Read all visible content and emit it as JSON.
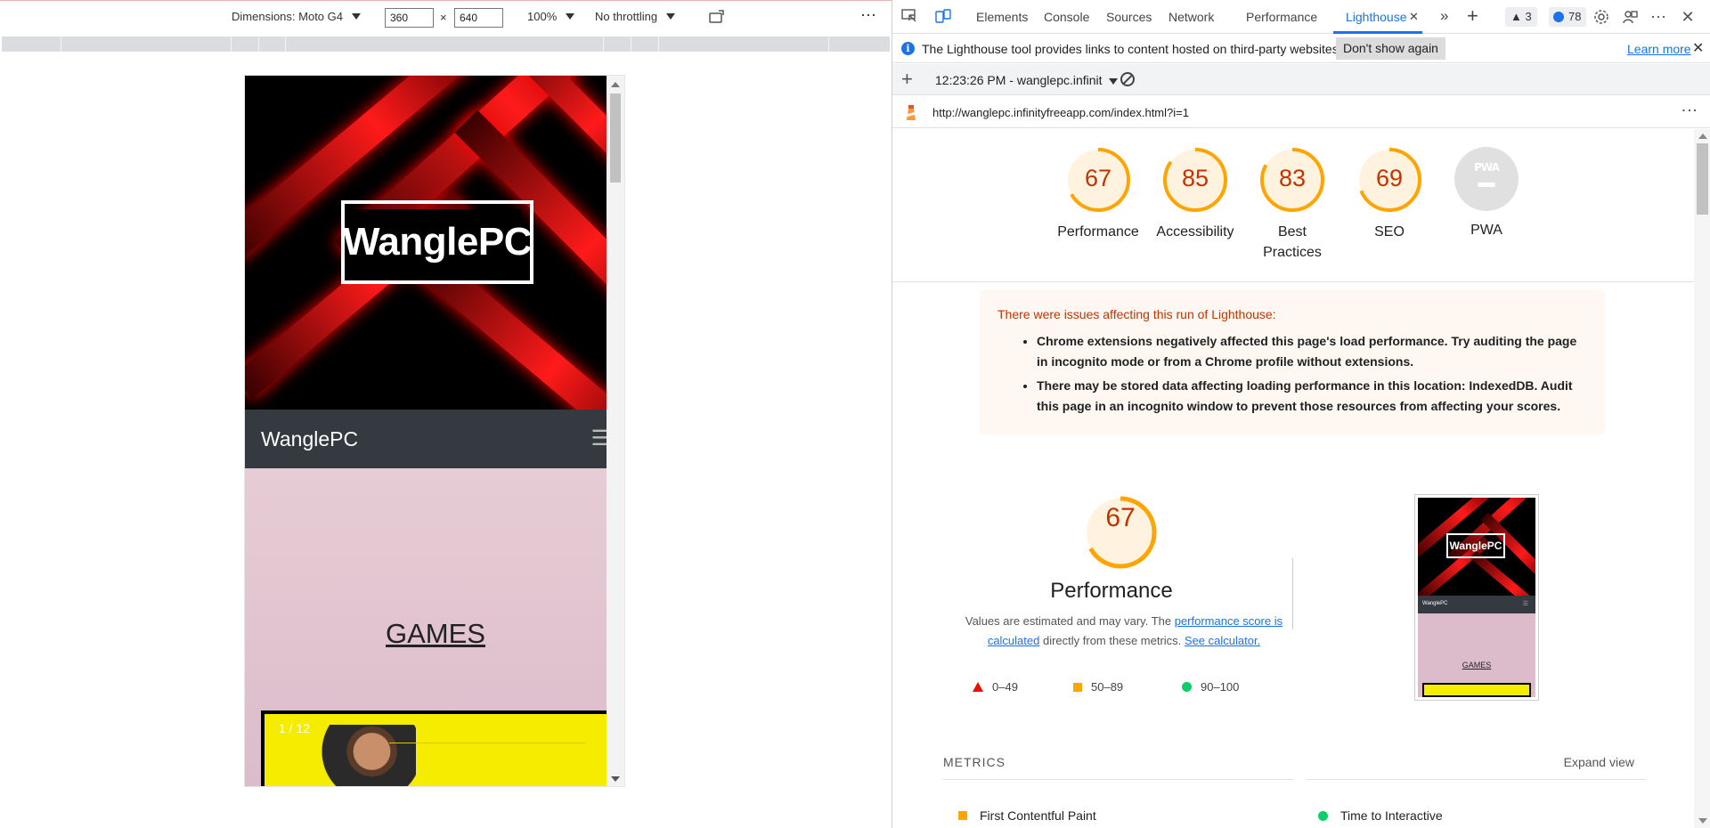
{
  "device_toolbar": {
    "dimensions_label": "Dimensions: Moto G4",
    "width_value": "360",
    "times": "×",
    "height_value": "640",
    "zoom": "100%",
    "throttling": "No throttling",
    "more": "⋯"
  },
  "emulated_page": {
    "logo_text": "WanglePC",
    "navbar_brand": "WanglePC",
    "hamburger": "☰",
    "section_title": "GAMES",
    "slide_counter": "1 / 12"
  },
  "devtools": {
    "tabs": [
      "Elements",
      "Console",
      "Sources",
      "Network",
      "Performance",
      "Lighthouse"
    ],
    "active_tab": "Lighthouse",
    "more_tabs": "»",
    "add_tab": "+",
    "warnings_badge": "▲ 3",
    "messages_badge": "78",
    "infobar": {
      "icon": "i",
      "message": "The Lighthouse tool provides links to content hosted on third-party websites.",
      "dont_show": "Don't show again",
      "learn_more": "Learn more",
      "close": "✕"
    },
    "report_selector": "12:23:26 PM - wanglepc.infinit",
    "url": "http://wanglepc.infinityfreeapp.com/index.html?i=1"
  },
  "scores": [
    {
      "label": "Performance",
      "score": 67,
      "line2": ""
    },
    {
      "label": "Accessibility",
      "score": 85,
      "line2": ""
    },
    {
      "label": "Best",
      "score": 83,
      "line2": "Practices"
    },
    {
      "label": "SEO",
      "score": 69,
      "line2": ""
    }
  ],
  "pwa": {
    "label": "PWA",
    "badge": "PWA"
  },
  "warning": {
    "title": "There were issues affecting this run of Lighthouse:",
    "items": [
      "Chrome extensions negatively affected this page's load performance. Try auditing the page in incognito mode or from a Chrome profile without extensions.",
      "There may be stored data affecting loading performance in this location: IndexedDB. Audit this page in an incognito window to prevent those resources from affecting your scores."
    ]
  },
  "performance": {
    "score": 67,
    "title": "Performance",
    "desc_prefix": "Values are estimated and may vary. The ",
    "link1": "performance score is calculated",
    "desc_mid": " directly from these metrics. ",
    "link2": "See calculator."
  },
  "legend": [
    {
      "range": "0–49",
      "shape": "triangle",
      "color": "#eb0f00"
    },
    {
      "range": "50–89",
      "shape": "square",
      "color": "#ffa400"
    },
    {
      "range": "90–100",
      "shape": "circle",
      "color": "#0cce6b"
    }
  ],
  "thumbnail": {
    "logo": "WanglePC",
    "nav": "WanglePC",
    "games": "GAMES"
  },
  "metrics": {
    "heading": "METRICS",
    "expand": "Expand view",
    "items": [
      {
        "name": "First Contentful Paint",
        "status": "average"
      },
      {
        "name": "Time to Interactive",
        "status": "pass"
      }
    ]
  },
  "colors": {
    "accent": "#1a73e8",
    "fail": "#eb0f00",
    "average": "#ffa400",
    "pass": "#0cce6b"
  }
}
